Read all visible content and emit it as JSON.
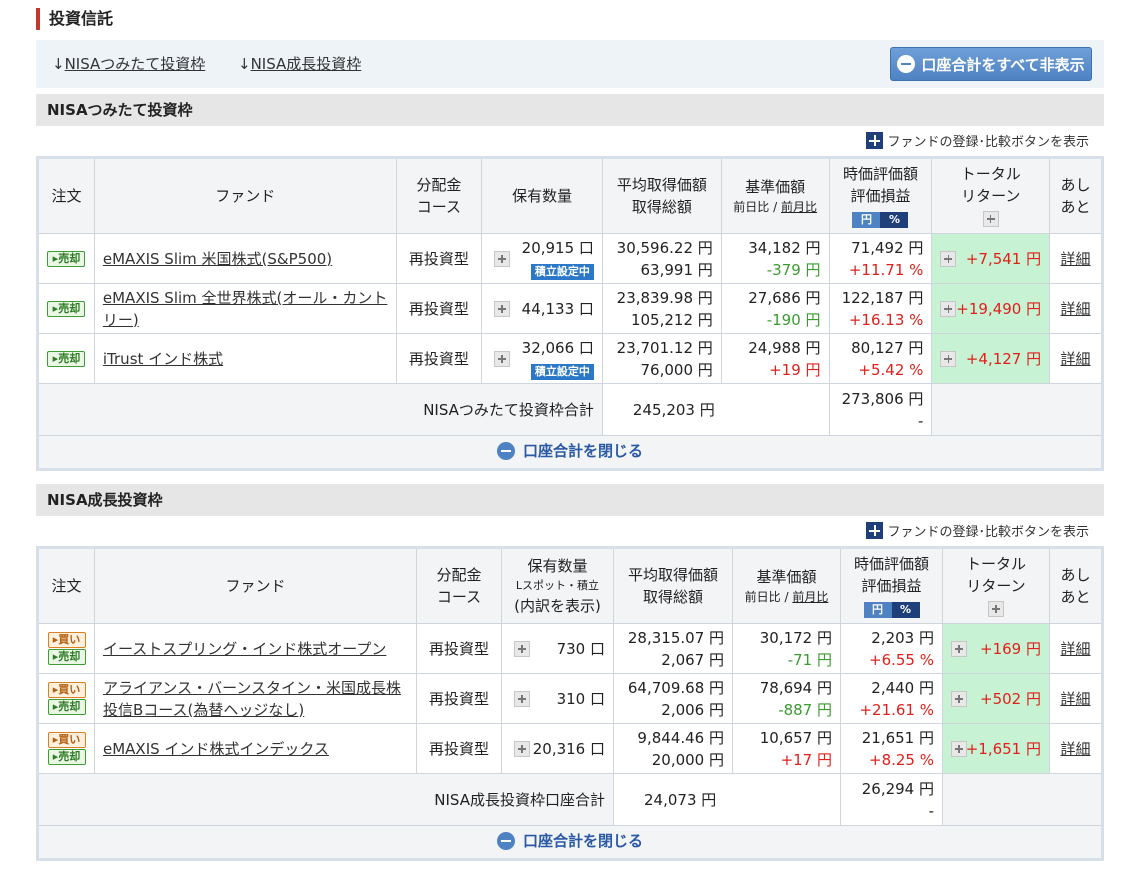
{
  "page": {
    "title": "投資信託"
  },
  "nav": {
    "link1": "NISAつみたて投資枠",
    "link2": "NISA成長投資枠",
    "hide_all_label": "口座合計をすべて非表示"
  },
  "fund_compare_label": "ファンドの登録･比較ボタンを表示",
  "headers": {
    "order": "注文",
    "fund": "ファンド",
    "course_l1": "分配金",
    "course_l2": "コース",
    "qty": "保有数量",
    "qty_sub1": "Lスポット・積立",
    "qty_sub2": "(内訳を表示)",
    "avg_l1": "平均取得価額",
    "avg_l2": "取得総額",
    "base_l1": "基準価額",
    "base_sub_a": "前日比",
    "base_sub_sep": " / ",
    "base_sub_b": "前月比",
    "eval_l1": "時価評価額",
    "eval_l2": "評価損益",
    "toggle_yen": "円",
    "toggle_pct": "%",
    "total_l1": "トータル",
    "total_l2": "リターン",
    "trend_l1": "あし",
    "trend_l2": "あと"
  },
  "labels": {
    "sell": "▸売却",
    "buy": "▸買い",
    "accum": "積立設定中",
    "detail": "詳細"
  },
  "tsumitate": {
    "section_title": "NISAつみたて投資枠",
    "rows": [
      {
        "fund": "eMAXIS Slim 米国株式(S&P500)",
        "course": "再投資型",
        "qty": "20,915 口",
        "accum": true,
        "avg": "30,596.22 円",
        "cost": "63,991 円",
        "base": "34,182 円",
        "diff": "-379 円",
        "diff_sign": "neg",
        "eval": "71,492 円",
        "pnl": "+11.71 %",
        "total": "+7,541 円"
      },
      {
        "fund": "eMAXIS Slim 全世界株式(オール・カントリー)",
        "course": "再投資型",
        "qty": "44,133 口",
        "accum": false,
        "avg": "23,839.98 円",
        "cost": "105,212 円",
        "base": "27,686 円",
        "diff": "-190 円",
        "diff_sign": "neg",
        "eval": "122,187 円",
        "pnl": "+16.13 %",
        "total": "+19,490 円"
      },
      {
        "fund": "iTrust インド株式",
        "course": "再投資型",
        "qty": "32,066 口",
        "accum": true,
        "avg": "23,701.12 円",
        "cost": "76,000 円",
        "base": "24,988 円",
        "diff": "+19 円",
        "diff_sign": "pos",
        "eval": "80,127 円",
        "pnl": "+5.42 %",
        "total": "+4,127 円"
      }
    ],
    "sum_label": "NISAつみたて投資枠合計",
    "sum_cost": "245,203 円",
    "sum_eval": "273,806 円",
    "sum_pnl": "-",
    "close_label": "口座合計を閉じる"
  },
  "growth": {
    "section_title": "NISA成長投資枠",
    "rows": [
      {
        "fund": "イーストスプリング・インド株式オープン",
        "course": "再投資型",
        "qty": "730 口",
        "avg": "28,315.07 円",
        "cost": "2,067 円",
        "base": "30,172 円",
        "diff": "-71 円",
        "diff_sign": "neg",
        "eval": "2,203 円",
        "pnl": "+6.55 %",
        "total": "+169 円"
      },
      {
        "fund": "アライアンス・バーンスタイン・米国成長株投信Bコース(為替ヘッジなし)",
        "course": "再投資型",
        "qty": "310 口",
        "avg": "64,709.68 円",
        "cost": "2,006 円",
        "base": "78,694 円",
        "diff": "-887 円",
        "diff_sign": "neg",
        "eval": "2,440 円",
        "pnl": "+21.61 %",
        "total": "+502 円"
      },
      {
        "fund": "eMAXIS インド株式インデックス",
        "course": "再投資型",
        "qty": "20,316 口",
        "avg": "9,844.46 円",
        "cost": "20,000 円",
        "base": "10,657 円",
        "diff": "+17 円",
        "diff_sign": "pos",
        "eval": "21,651 円",
        "pnl": "+8.25 %",
        "total": "+1,651 円"
      }
    ],
    "sum_label": "NISA成長投資枠口座合計",
    "sum_cost": "24,073 円",
    "sum_eval": "26,294 円",
    "sum_pnl": "-",
    "close_label": "口座合計を閉じる"
  },
  "colors": {
    "positive": "#e0201b",
    "negative": "#3a9b2f",
    "total_bg": "#c7f2d3",
    "accent": "#4f82c2"
  }
}
